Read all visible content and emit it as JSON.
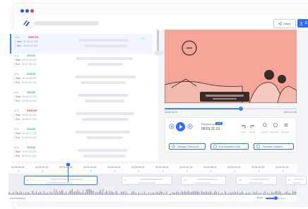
{
  "colors": {
    "accent": "#2f6bff",
    "status_error": "#e24b4b",
    "status_ok": "#2bb673",
    "video_bg": "#f4a598"
  },
  "header": {
    "share_label": "Share",
    "share_icon": "share-icon",
    "export_icon": "upload-icon",
    "export_label": "E"
  },
  "subtitles": [
    {
      "index": "10",
      "status": "ERROR",
      "status_color": "#e24b4b",
      "start": "00:00:33.200",
      "end": "00:00:35.200",
      "active": true
    },
    {
      "index": "11",
      "status": "GOOD",
      "status_color": "#2bb673",
      "start": "00:00:35.220",
      "end": "00:00:38.220",
      "active": false
    },
    {
      "index": "12",
      "status": "GOOD",
      "status_color": "#2bb673",
      "start": "00:00:38.220",
      "end": "00:00:41.220",
      "active": false
    },
    {
      "index": "13",
      "status": "GOOD",
      "status_color": "#2bb673",
      "start": "00:00:41.220",
      "end": "00:00:44.220",
      "active": false
    },
    {
      "index": "14",
      "status": "ERROR",
      "status_color": "#e24b4b",
      "start": "00:00:44.220",
      "end": "00:00:47.220",
      "active": false
    },
    {
      "index": "15",
      "status": "GOOD",
      "status_color": "#2bb673",
      "start": "00:00:47.220",
      "end": "00:00:50.220",
      "active": false
    },
    {
      "index": "16",
      "status": "GOOD",
      "status_color": "#2bb673",
      "start": "00:00:50.220",
      "end": "00:00:53.220",
      "active": false
    }
  ],
  "labels": {
    "start": "Start",
    "end": "End"
  },
  "player": {
    "progress": 0.58,
    "time_current": "00:00:33.23",
    "time_total": "00:01:21.00"
  },
  "controls": {
    "speed_label": "Playback speed",
    "speed_value": "1.0X",
    "timecode": "00:01:11.13",
    "undo_label": "Undo",
    "redo_label": "Redo",
    "search_label": "Search",
    "shortcuts_label": "Shortcuts",
    "settings_label": "Settings",
    "actions": [
      "Manage Timecodes",
      "Edit Subtitles Limits",
      "Translate Subtitles"
    ]
  },
  "timeline": {
    "ruler": [
      "00:00:30.00",
      "00:00:31.00",
      "00:00:32.00",
      "00:00:33.00",
      "00:00:34.00",
      "00:00:35.00",
      "00:00:36.00",
      "00:00:37.00",
      "00:00:38.00",
      "00:00:39.00",
      "00:00:40.00",
      "00:00:41.00"
    ],
    "clips": [
      "10",
      "11",
      "12",
      "13",
      "14"
    ],
    "zoom_label": "Zoom",
    "zoom_level": 0.5
  }
}
